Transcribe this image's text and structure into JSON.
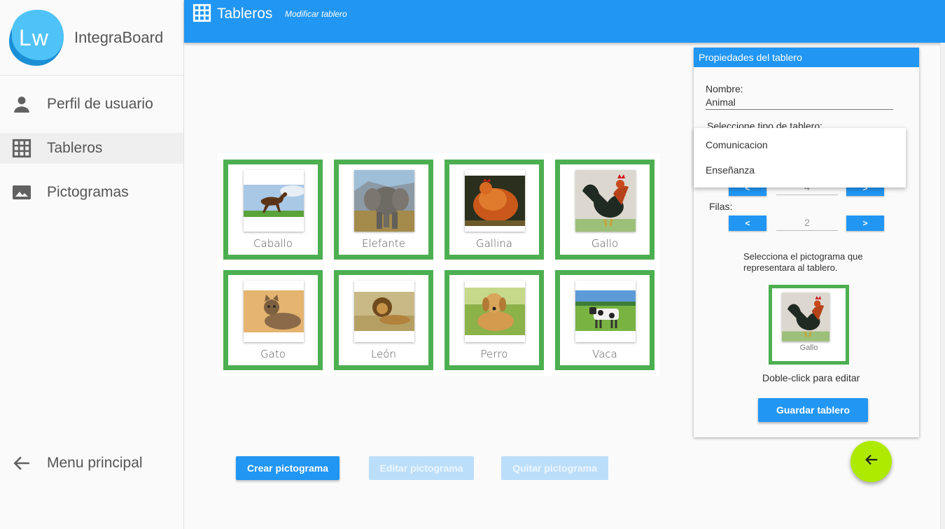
{
  "app": {
    "brand_logo_text": "Lw",
    "brand_name": "IntegraBoard"
  },
  "sidebar": {
    "items": [
      {
        "label": "Perfil de usuario",
        "icon": "person-icon"
      },
      {
        "label": "Tableros",
        "icon": "grid-icon",
        "active": true
      },
      {
        "label": "Pictogramas",
        "icon": "image-icon"
      }
    ],
    "bottom_item": {
      "label": "Menu principal",
      "icon": "arrow-left-icon"
    }
  },
  "topbar": {
    "title": "Tableros",
    "subtitle": "Modificar tablero"
  },
  "board": {
    "tiles": [
      {
        "label": "Caballo"
      },
      {
        "label": "Elefante"
      },
      {
        "label": "Gallina"
      },
      {
        "label": "Gallo"
      },
      {
        "label": "Gato"
      },
      {
        "label": "León"
      },
      {
        "label": "Perro"
      },
      {
        "label": "Vaca"
      }
    ]
  },
  "actions": {
    "create": "Crear pictograma",
    "edit": "Editar pictograma",
    "remove": "Quitar pictograma"
  },
  "panel": {
    "header": "Propiedades del tablero",
    "name_label": "Nombre:",
    "name_value": "Animal",
    "type_label": "Seleccione tipo de tablero:",
    "columns_value": "4",
    "rows_label": "Filas:",
    "rows_value": "2",
    "prev_symbol": "<",
    "next_symbol": ">",
    "pictogram_prompt": "Selecciona el pictograma que representara al tablero.",
    "selected_pictogram": "Gallo",
    "double_click_hint": "Doble-click para editar",
    "save_label": "Guardar tablero"
  },
  "dropdown": {
    "options": [
      "Comunicacion",
      "Enseñanza"
    ]
  },
  "colors": {
    "primary": "#2196f3",
    "tile_border": "#4caf50",
    "fab": "#aeea00"
  }
}
